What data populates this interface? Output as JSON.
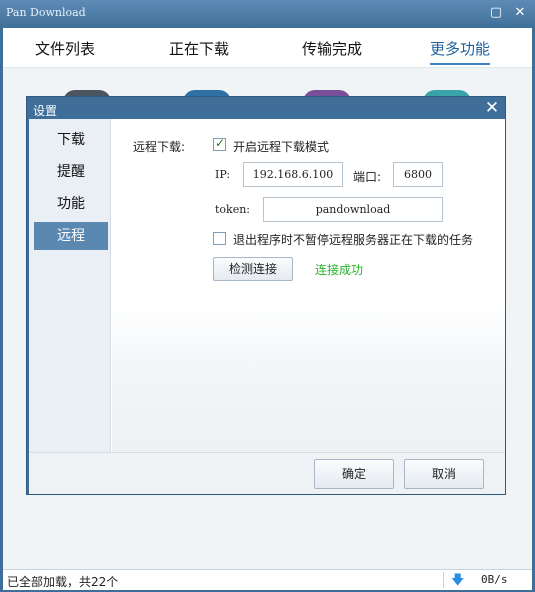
{
  "window": {
    "title": "Pan Download",
    "minimize_glyph": "▢",
    "close_glyph": "✕"
  },
  "tabs": [
    {
      "label": "文件列表"
    },
    {
      "label": "正在下载"
    },
    {
      "label": "传输完成"
    },
    {
      "label": "更多功能",
      "active": true
    }
  ],
  "dialog": {
    "title": "设置",
    "close_glyph": "✕",
    "sidebar": [
      {
        "label": "下载"
      },
      {
        "label": "提醒"
      },
      {
        "label": "功能"
      },
      {
        "label": "远程",
        "active": true
      }
    ],
    "remote": {
      "section_label": "远程下载:",
      "enable_label": "开启远程下载模式",
      "enable_checked": true,
      "ip_label": "IP:",
      "ip_value": "192.168.6.100",
      "port_label": "端口:",
      "port_value": "6800",
      "token_label": "token:",
      "token_value": "pandownload",
      "keep_label": "退出程序时不暂停远程服务器正在下载的任务",
      "keep_checked": false,
      "test_button": "检测连接",
      "status_text": "连接成功",
      "status_color": "#27b327"
    },
    "ok_button": "确定",
    "cancel_button": "取消"
  },
  "statusbar": {
    "text": "已全部加载，共22个",
    "download_icon": "download-arrow-icon",
    "speed": "0B/s"
  },
  "colors": {
    "accent": "#3f6f98",
    "sidebar_active": "#5b88b0",
    "success": "#27b327"
  }
}
